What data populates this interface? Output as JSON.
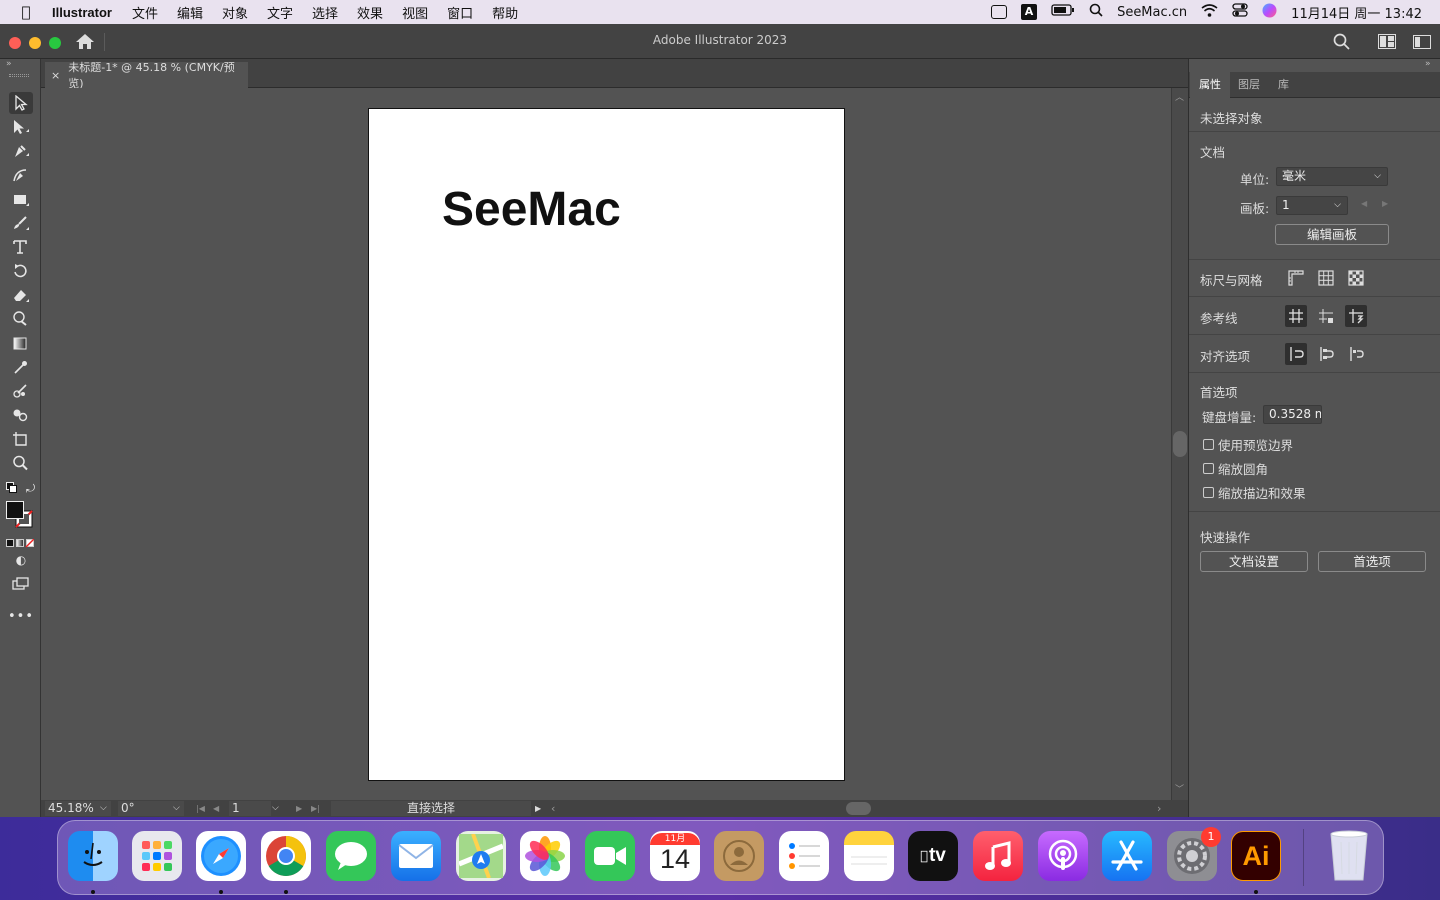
{
  "menubar": {
    "app_name": "Illustrator",
    "items": [
      "文件",
      "编辑",
      "对象",
      "文字",
      "选择",
      "效果",
      "视图",
      "窗口",
      "帮助"
    ],
    "website": "SeeMac.cn",
    "datetime": "11月14日 周一  13:42",
    "input_source": "A"
  },
  "window": {
    "title": "Adobe Illustrator 2023"
  },
  "document_tab": {
    "close": "×",
    "label": "未标题-1* @ 45.18 % (CMYK/预览)"
  },
  "artboard": {
    "text": "SeeMac"
  },
  "statusbar": {
    "zoom": "45.18%",
    "rotation": "0°",
    "artboard_num": "1",
    "tool_name": "直接选择"
  },
  "panel": {
    "tabs": [
      "属性",
      "图层",
      "库"
    ],
    "no_selection": "未选择对象",
    "document_heading": "文档",
    "unit_label": "单位:",
    "unit_value": "毫米",
    "artboard_label": "画板:",
    "artboard_value": "1",
    "edit_artboard_button": "编辑画板",
    "rulers_grids": "标尺与网格",
    "guides": "参考线",
    "align_options": "对齐选项",
    "preferences_heading": "首选项",
    "keyboard_increment_label": "键盘增量:",
    "keyboard_increment_value": "0.3528 m",
    "checkbox_preview_bounds": "使用预览边界",
    "checkbox_scale_corners": "缩放圆角",
    "checkbox_scale_strokes": "缩放描边和效果",
    "quick_actions_heading": "快速操作",
    "document_setup_button": "文档设置",
    "preferences_button": "首选项"
  },
  "dock": {
    "calendar_month": "11月",
    "calendar_day": "14",
    "tv_label": "tv",
    "settings_badge": "1",
    "ai_label": "Ai"
  },
  "colors": {
    "ai_icon_bg": "#330000",
    "ai_icon_fg": "#ff9a00",
    "accent_panel": "#535353"
  }
}
